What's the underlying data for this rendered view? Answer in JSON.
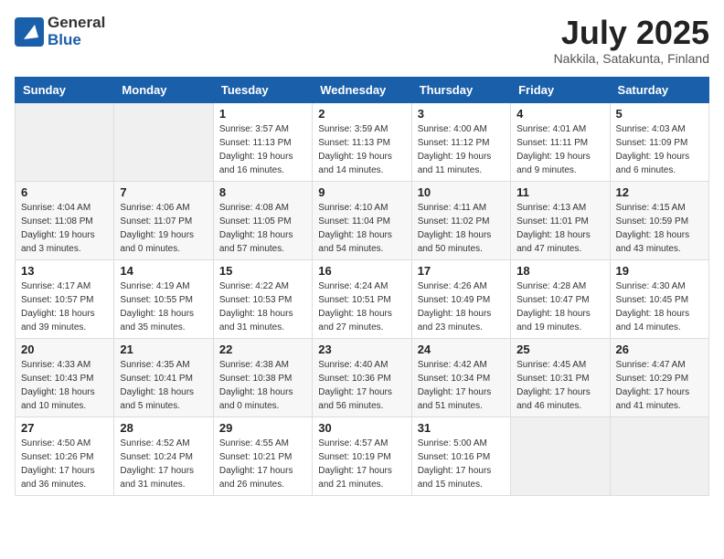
{
  "header": {
    "logo_general": "General",
    "logo_blue": "Blue",
    "month_title": "July 2025",
    "location": "Nakkila, Satakunta, Finland"
  },
  "weekdays": [
    "Sunday",
    "Monday",
    "Tuesday",
    "Wednesday",
    "Thursday",
    "Friday",
    "Saturday"
  ],
  "weeks": [
    [
      {
        "day": "",
        "info": ""
      },
      {
        "day": "",
        "info": ""
      },
      {
        "day": "1",
        "info": "Sunrise: 3:57 AM\nSunset: 11:13 PM\nDaylight: 19 hours\nand 16 minutes."
      },
      {
        "day": "2",
        "info": "Sunrise: 3:59 AM\nSunset: 11:13 PM\nDaylight: 19 hours\nand 14 minutes."
      },
      {
        "day": "3",
        "info": "Sunrise: 4:00 AM\nSunset: 11:12 PM\nDaylight: 19 hours\nand 11 minutes."
      },
      {
        "day": "4",
        "info": "Sunrise: 4:01 AM\nSunset: 11:11 PM\nDaylight: 19 hours\nand 9 minutes."
      },
      {
        "day": "5",
        "info": "Sunrise: 4:03 AM\nSunset: 11:09 PM\nDaylight: 19 hours\nand 6 minutes."
      }
    ],
    [
      {
        "day": "6",
        "info": "Sunrise: 4:04 AM\nSunset: 11:08 PM\nDaylight: 19 hours\nand 3 minutes."
      },
      {
        "day": "7",
        "info": "Sunrise: 4:06 AM\nSunset: 11:07 PM\nDaylight: 19 hours\nand 0 minutes."
      },
      {
        "day": "8",
        "info": "Sunrise: 4:08 AM\nSunset: 11:05 PM\nDaylight: 18 hours\nand 57 minutes."
      },
      {
        "day": "9",
        "info": "Sunrise: 4:10 AM\nSunset: 11:04 PM\nDaylight: 18 hours\nand 54 minutes."
      },
      {
        "day": "10",
        "info": "Sunrise: 4:11 AM\nSunset: 11:02 PM\nDaylight: 18 hours\nand 50 minutes."
      },
      {
        "day": "11",
        "info": "Sunrise: 4:13 AM\nSunset: 11:01 PM\nDaylight: 18 hours\nand 47 minutes."
      },
      {
        "day": "12",
        "info": "Sunrise: 4:15 AM\nSunset: 10:59 PM\nDaylight: 18 hours\nand 43 minutes."
      }
    ],
    [
      {
        "day": "13",
        "info": "Sunrise: 4:17 AM\nSunset: 10:57 PM\nDaylight: 18 hours\nand 39 minutes."
      },
      {
        "day": "14",
        "info": "Sunrise: 4:19 AM\nSunset: 10:55 PM\nDaylight: 18 hours\nand 35 minutes."
      },
      {
        "day": "15",
        "info": "Sunrise: 4:22 AM\nSunset: 10:53 PM\nDaylight: 18 hours\nand 31 minutes."
      },
      {
        "day": "16",
        "info": "Sunrise: 4:24 AM\nSunset: 10:51 PM\nDaylight: 18 hours\nand 27 minutes."
      },
      {
        "day": "17",
        "info": "Sunrise: 4:26 AM\nSunset: 10:49 PM\nDaylight: 18 hours\nand 23 minutes."
      },
      {
        "day": "18",
        "info": "Sunrise: 4:28 AM\nSunset: 10:47 PM\nDaylight: 18 hours\nand 19 minutes."
      },
      {
        "day": "19",
        "info": "Sunrise: 4:30 AM\nSunset: 10:45 PM\nDaylight: 18 hours\nand 14 minutes."
      }
    ],
    [
      {
        "day": "20",
        "info": "Sunrise: 4:33 AM\nSunset: 10:43 PM\nDaylight: 18 hours\nand 10 minutes."
      },
      {
        "day": "21",
        "info": "Sunrise: 4:35 AM\nSunset: 10:41 PM\nDaylight: 18 hours\nand 5 minutes."
      },
      {
        "day": "22",
        "info": "Sunrise: 4:38 AM\nSunset: 10:38 PM\nDaylight: 18 hours\nand 0 minutes."
      },
      {
        "day": "23",
        "info": "Sunrise: 4:40 AM\nSunset: 10:36 PM\nDaylight: 17 hours\nand 56 minutes."
      },
      {
        "day": "24",
        "info": "Sunrise: 4:42 AM\nSunset: 10:34 PM\nDaylight: 17 hours\nand 51 minutes."
      },
      {
        "day": "25",
        "info": "Sunrise: 4:45 AM\nSunset: 10:31 PM\nDaylight: 17 hours\nand 46 minutes."
      },
      {
        "day": "26",
        "info": "Sunrise: 4:47 AM\nSunset: 10:29 PM\nDaylight: 17 hours\nand 41 minutes."
      }
    ],
    [
      {
        "day": "27",
        "info": "Sunrise: 4:50 AM\nSunset: 10:26 PM\nDaylight: 17 hours\nand 36 minutes."
      },
      {
        "day": "28",
        "info": "Sunrise: 4:52 AM\nSunset: 10:24 PM\nDaylight: 17 hours\nand 31 minutes."
      },
      {
        "day": "29",
        "info": "Sunrise: 4:55 AM\nSunset: 10:21 PM\nDaylight: 17 hours\nand 26 minutes."
      },
      {
        "day": "30",
        "info": "Sunrise: 4:57 AM\nSunset: 10:19 PM\nDaylight: 17 hours\nand 21 minutes."
      },
      {
        "day": "31",
        "info": "Sunrise: 5:00 AM\nSunset: 10:16 PM\nDaylight: 17 hours\nand 15 minutes."
      },
      {
        "day": "",
        "info": ""
      },
      {
        "day": "",
        "info": ""
      }
    ]
  ]
}
